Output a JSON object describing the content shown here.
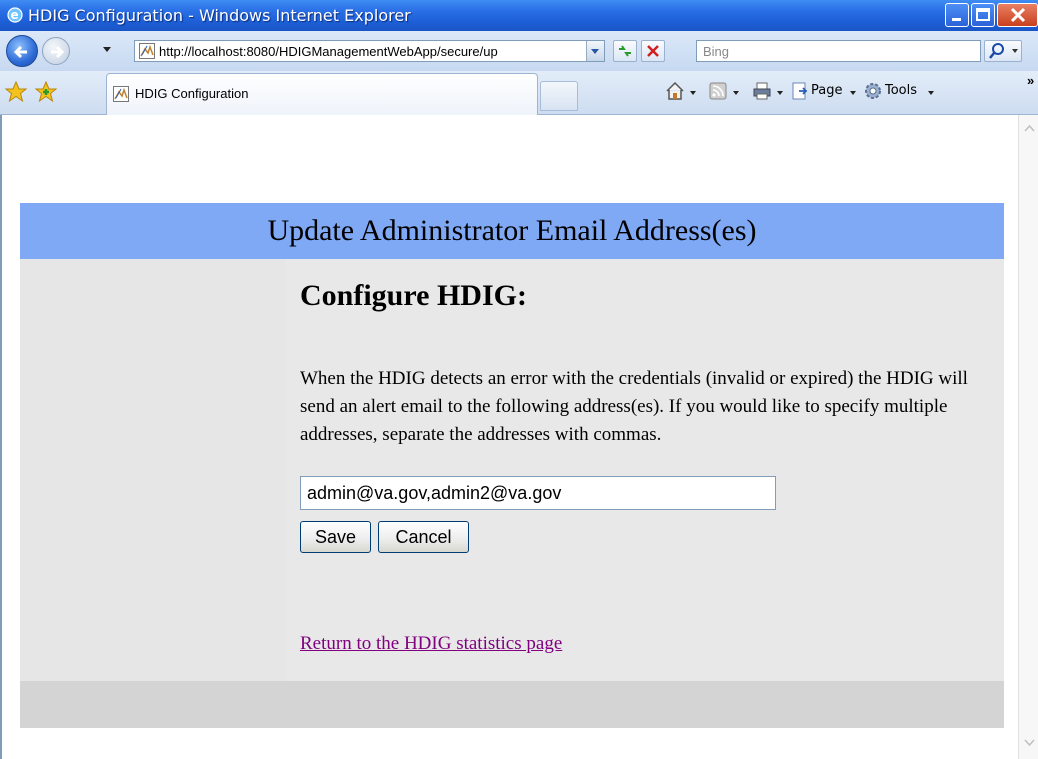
{
  "window": {
    "title": "HDIG Configuration - Windows Internet Explorer"
  },
  "address_bar": {
    "url": "http://localhost:8080/HDIGManagementWebApp/secure/up",
    "search_placeholder": "Bing"
  },
  "tabs": [
    {
      "label": "HDIG Configuration"
    }
  ],
  "command_bar": {
    "page_label": "Page",
    "tools_label": "Tools"
  },
  "page": {
    "banner_title": "Update Administrator Email Address(es)",
    "heading": "Configure HDIG:",
    "description": "When the HDIG detects an error with the credentials (invalid or expired) the HDIG will send an alert email to the following address(es). If you would like to specify multiple addresses, separate the addresses with commas.",
    "email_value": "admin@va.gov,admin2@va.gov",
    "save_label": "Save",
    "cancel_label": "Cancel",
    "return_link": "Return to the HDIG statistics page"
  },
  "colors": {
    "banner": "#7fa8f5",
    "titlebar": "#2a6fe6",
    "visited_link": "#800080"
  }
}
